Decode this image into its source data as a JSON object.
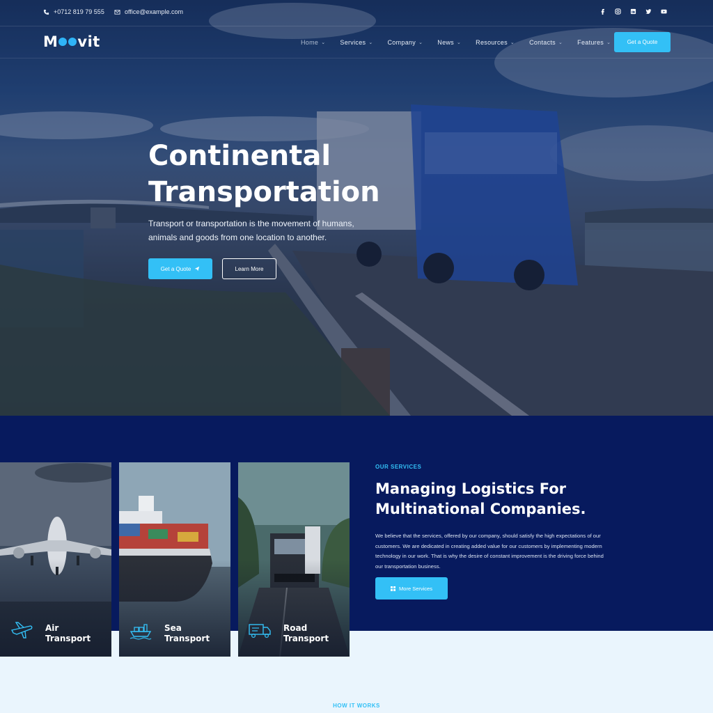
{
  "topbar": {
    "phone": "+0712 819 79 555",
    "email": "office@example.com",
    "social_icons": [
      "facebook-icon",
      "instagram-icon",
      "linkedin-icon",
      "twitter-icon",
      "youtube-icon"
    ]
  },
  "header": {
    "logo": "Moovit",
    "nav": [
      {
        "label": "Home"
      },
      {
        "label": "Services"
      },
      {
        "label": "Company"
      },
      {
        "label": "News"
      },
      {
        "label": "Resources"
      },
      {
        "label": "Contacts"
      },
      {
        "label": "Features"
      }
    ],
    "cta": "Get a Quote"
  },
  "hero": {
    "title_line1": "Continental",
    "title_line2": "Transportation",
    "subtitle": "Transport or transportation is the movement of humans, animals and goods from one location to another.",
    "primary_button": "Get a Quote",
    "secondary_button": "Learn More"
  },
  "services": {
    "cards": [
      {
        "line1": "Air",
        "line2": "Transport"
      },
      {
        "line1": "Sea",
        "line2": "Transport"
      },
      {
        "line1": "Road",
        "line2": "Transport"
      }
    ],
    "eyebrow": "OUR SERVICES",
    "title": "Managing Logistics For Multinational Companies.",
    "body": "We believe that the services, offered by our company, should satisfy the high expectations of our customers. We are dedicated in creating added value for our customers by implementing modern technology in our work. That is why the desire of constant improvement is the driving force behind our transportation business.",
    "button": "More Services"
  },
  "next_section": {
    "eyebrow": "HOW IT WORKS"
  },
  "colors": {
    "accent": "#33c0f6",
    "navy": "#071a5e",
    "light": "#eaf5fd"
  }
}
